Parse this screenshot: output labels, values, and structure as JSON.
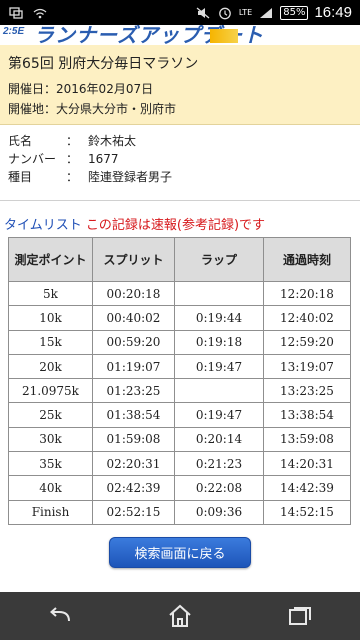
{
  "status_bar": {
    "time": "16:49",
    "battery": "85%",
    "network": "LTE",
    "icons": [
      "screen-mirror-icon",
      "wifi-icon",
      "mute-icon",
      "alarm-icon",
      "signal-icon"
    ]
  },
  "logo": {
    "sub": "2:5E",
    "text": "ランナーズアップデート"
  },
  "race": {
    "title": "第65回 別府大分毎日マラソン",
    "date_label": "開催日：",
    "date_value": "2016年02月07日",
    "place_label": "開催地：",
    "place_value": "大分県大分市・別府市"
  },
  "runner": {
    "name_label": "氏名",
    "name_value": "鈴木祐太",
    "number_label": "ナンバー",
    "number_value": "1677",
    "category_label": "種目",
    "category_value": "陸連登録者男子",
    "colon": "："
  },
  "timelist": {
    "title": "タイムリスト",
    "note": "この記録は速報(参考記録)です",
    "headers": [
      "測定ポイント",
      "スプリット",
      "ラップ",
      "通過時刻"
    ],
    "rows": [
      [
        "5k",
        "00:20:18",
        "",
        "12:20:18"
      ],
      [
        "10k",
        "00:40:02",
        "0:19:44",
        "12:40:02"
      ],
      [
        "15k",
        "00:59:20",
        "0:19:18",
        "12:59:20"
      ],
      [
        "20k",
        "01:19:07",
        "0:19:47",
        "13:19:07"
      ],
      [
        "21.0975k",
        "01:23:25",
        "",
        "13:23:25"
      ],
      [
        "25k",
        "01:38:54",
        "0:19:47",
        "13:38:54"
      ],
      [
        "30k",
        "01:59:08",
        "0:20:14",
        "13:59:08"
      ],
      [
        "35k",
        "02:20:31",
        "0:21:23",
        "14:20:31"
      ],
      [
        "40k",
        "02:42:39",
        "0:22:08",
        "14:42:39"
      ],
      [
        "Finish",
        "02:52:15",
        "0:09:36",
        "14:52:15"
      ]
    ]
  },
  "back_button": {
    "label": "検索画面に戻る"
  },
  "nav": {
    "icons": [
      "back-icon",
      "home-icon",
      "recent-apps-icon"
    ]
  }
}
